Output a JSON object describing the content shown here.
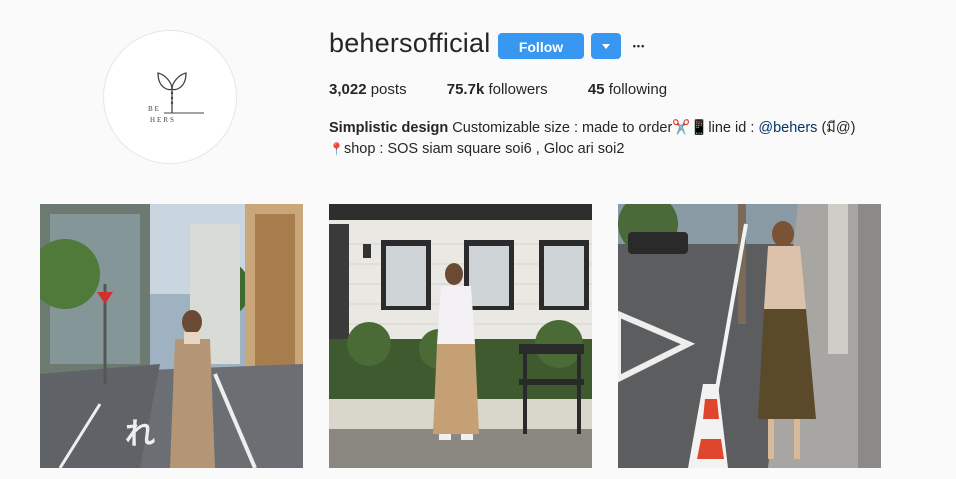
{
  "profile": {
    "username": "behersofficial",
    "follow_label": "Follow",
    "more_label": "•••",
    "logo_text": "BE HERS",
    "stats": {
      "posts_count": "3,022",
      "posts_label": "posts",
      "followers_count": "75.7k",
      "followers_label": "followers",
      "following_count": "45",
      "following_label": "following"
    },
    "bio": {
      "name": "Simplistic design",
      "line1_text": "Customizable size : made to order✂️📱line id : ",
      "mention": "@behers",
      "line1_tail": " (มี@)",
      "line2_text": "shop : SOS siam square soi6 , Gloc ari soi2"
    }
  },
  "colors": {
    "accent": "#3897f0",
    "background": "#fafafa",
    "text": "#262626",
    "mention": "#003569"
  },
  "posts": [
    {
      "icon": "street-photo"
    },
    {
      "icon": "brick-wall-photo"
    },
    {
      "icon": "road-photo"
    }
  ]
}
